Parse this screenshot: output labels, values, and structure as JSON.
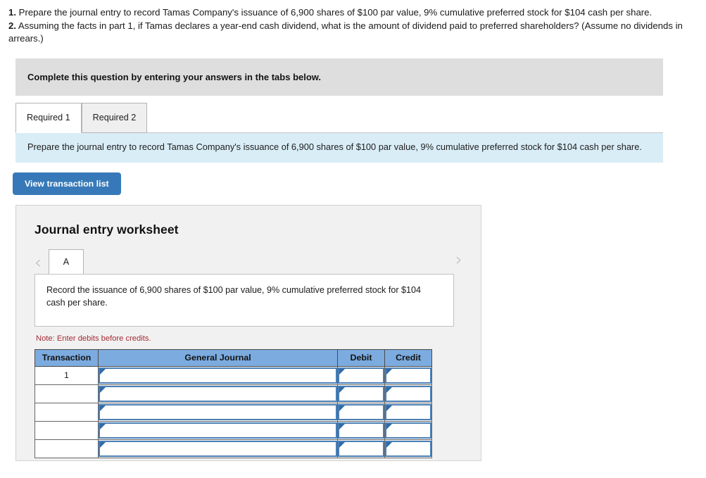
{
  "prompt": {
    "item1_num": "1.",
    "item1_text": " Prepare the journal entry to record Tamas Company's issuance of 6,900 shares of $100 par value, 9% cumulative preferred stock for $104 cash per share.",
    "item2_num": "2.",
    "item2_text": " Assuming the facts in part 1, if Tamas declares a year-end cash dividend, what is the amount of dividend paid to preferred shareholders? (Assume no dividends in arrears.)"
  },
  "banner": {
    "text": "Complete this question by entering your answers in the tabs below."
  },
  "tabs": [
    {
      "label": "Required 1",
      "active": true
    },
    {
      "label": "Required 2",
      "active": false
    }
  ],
  "info_panel": {
    "text": "Prepare the journal entry to record Tamas Company's issuance of 6,900 shares of $100 par value, 9% cumulative preferred stock for $104 cash per share."
  },
  "transaction_button": {
    "label": "View transaction list"
  },
  "worksheet": {
    "title": "Journal entry worksheet",
    "prev_chevron": "‹",
    "next_chevron": "›",
    "sheet_tab": "A",
    "description": "Record the issuance of 6,900 shares of $100 par value, 9% cumulative preferred stock for $104 cash per share.",
    "note": "Note: Enter debits before credits.",
    "table": {
      "headers": [
        "Transaction",
        "General Journal",
        "Debit",
        "Credit"
      ],
      "rows": [
        {
          "transaction": "1",
          "general_journal": "",
          "debit": "",
          "credit": ""
        },
        {
          "transaction": "",
          "general_journal": "",
          "debit": "",
          "credit": ""
        },
        {
          "transaction": "",
          "general_journal": "",
          "debit": "",
          "credit": ""
        },
        {
          "transaction": "",
          "general_journal": "",
          "debit": "",
          "credit": ""
        },
        {
          "transaction": "",
          "general_journal": "",
          "debit": "",
          "credit": ""
        }
      ]
    }
  },
  "colors": {
    "header_blue": "#7cabe0",
    "button_blue": "#3779b8",
    "info_blue": "#d9edf7",
    "banner_grey": "#dedede",
    "note_red": "#a32c36",
    "cell_border_blue": "#4a7fb5"
  }
}
